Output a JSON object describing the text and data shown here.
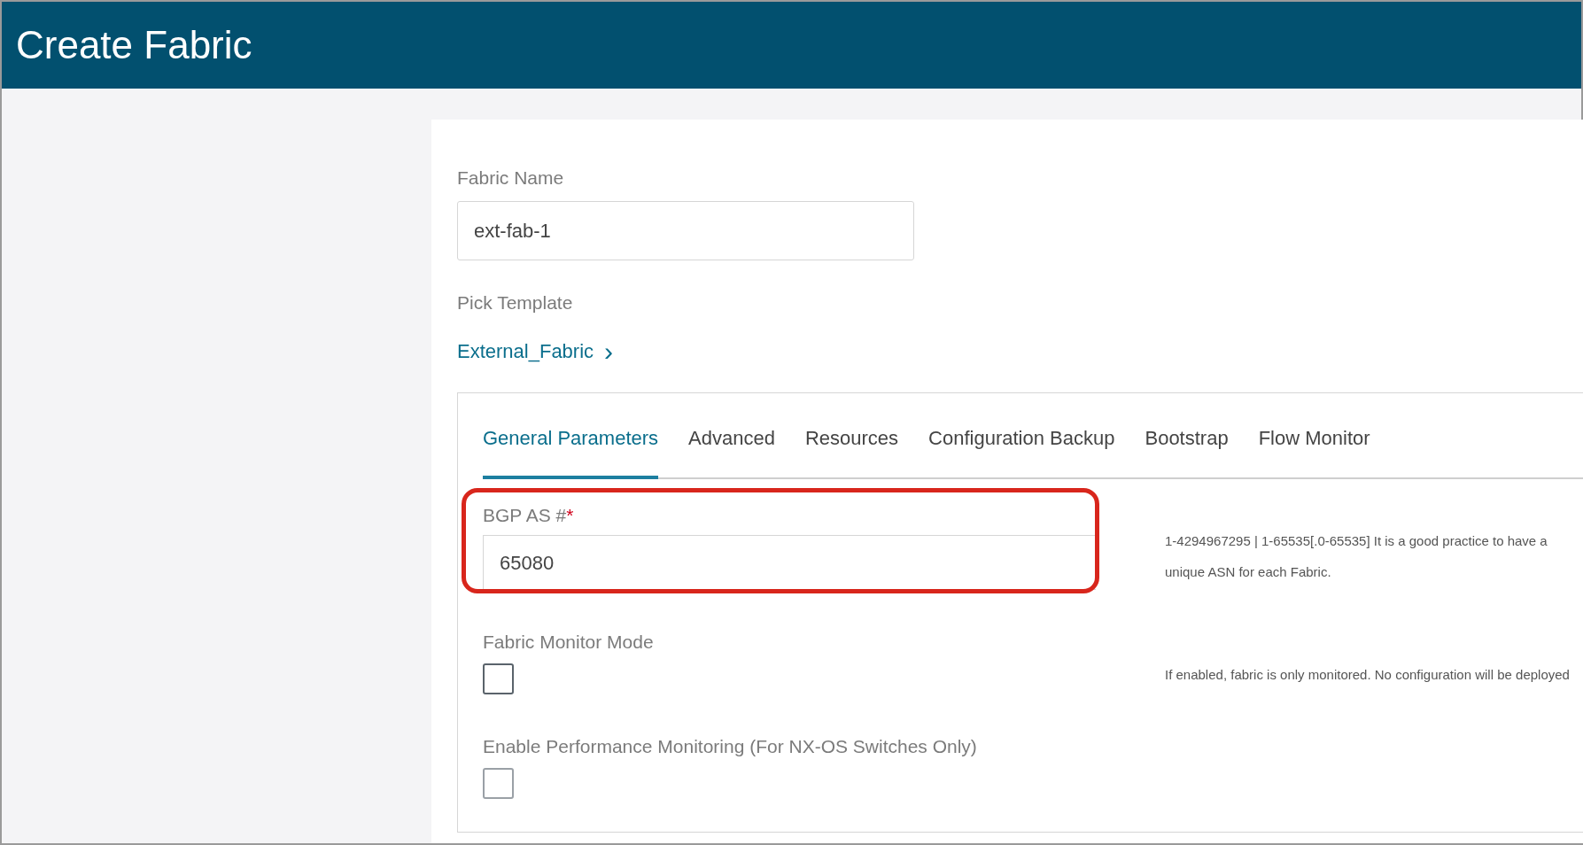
{
  "window": {
    "title": "Create Fabric"
  },
  "fabric_name": {
    "label": "Fabric Name",
    "value": "ext-fab-1"
  },
  "template": {
    "label": "Pick Template",
    "value": "External_Fabric",
    "chevron": "›"
  },
  "tabs": [
    {
      "label": "General Parameters",
      "selected": true
    },
    {
      "label": "Advanced",
      "selected": false
    },
    {
      "label": "Resources",
      "selected": false
    },
    {
      "label": "Configuration Backup",
      "selected": false
    },
    {
      "label": "Bootstrap",
      "selected": false
    },
    {
      "label": "Flow Monitor",
      "selected": false
    }
  ],
  "fields": [
    {
      "kind": "text",
      "label": "BGP AS #",
      "required_mark": "*",
      "value": "65080",
      "highlighted": true,
      "help": "1-4294967295 | 1-65535[.0-65535] It is a good practice to have a unique ASN for each Fabric."
    },
    {
      "kind": "checkbox",
      "label": "Fabric Monitor Mode",
      "checked": false,
      "highlighted": false,
      "help": "If enabled, fabric is only monitored. No configuration will be deployed"
    },
    {
      "kind": "checkbox",
      "label": "Enable Performance Monitoring (For NX-OS Switches Only)",
      "checked": false,
      "highlighted": false
    }
  ]
}
